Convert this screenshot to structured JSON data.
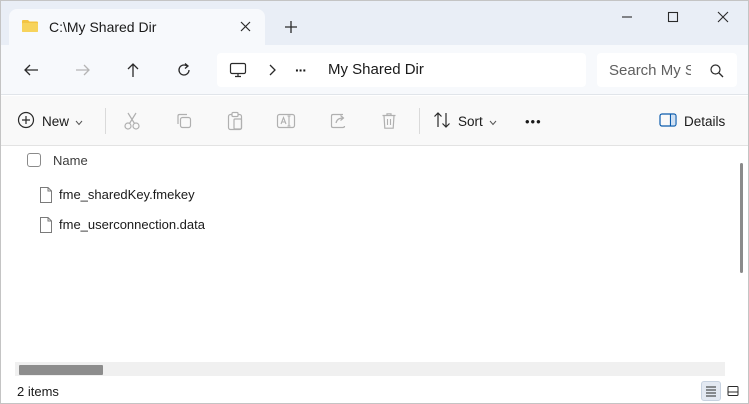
{
  "tab": {
    "title": "C:\\My Shared Dir",
    "icon": "folder-icon",
    "folder_color": "#f3c443"
  },
  "window_controls": [
    "minimize-icon",
    "maximize-icon",
    "close-icon"
  ],
  "address": {
    "ellipsis": "···",
    "current_folder": "My Shared Dir"
  },
  "search": {
    "placeholder": "Search My Shared Dir"
  },
  "toolbar": {
    "new_label": "New",
    "sort_label": "Sort",
    "more_label": "•••",
    "details_label": "Details",
    "disabled_actions": [
      "cut-icon",
      "copy-icon",
      "paste-icon",
      "rename-icon",
      "share-icon",
      "delete-icon"
    ]
  },
  "file_list": {
    "column_name": "Name",
    "files": [
      {
        "name": "fme_sharedKey.fmekey"
      },
      {
        "name": "fme_userconnection.data"
      }
    ]
  },
  "status": {
    "item_count": "2 items"
  },
  "colors": {
    "titlebar_bg": "#e9eef6",
    "details_accent": "#0b5cad"
  }
}
